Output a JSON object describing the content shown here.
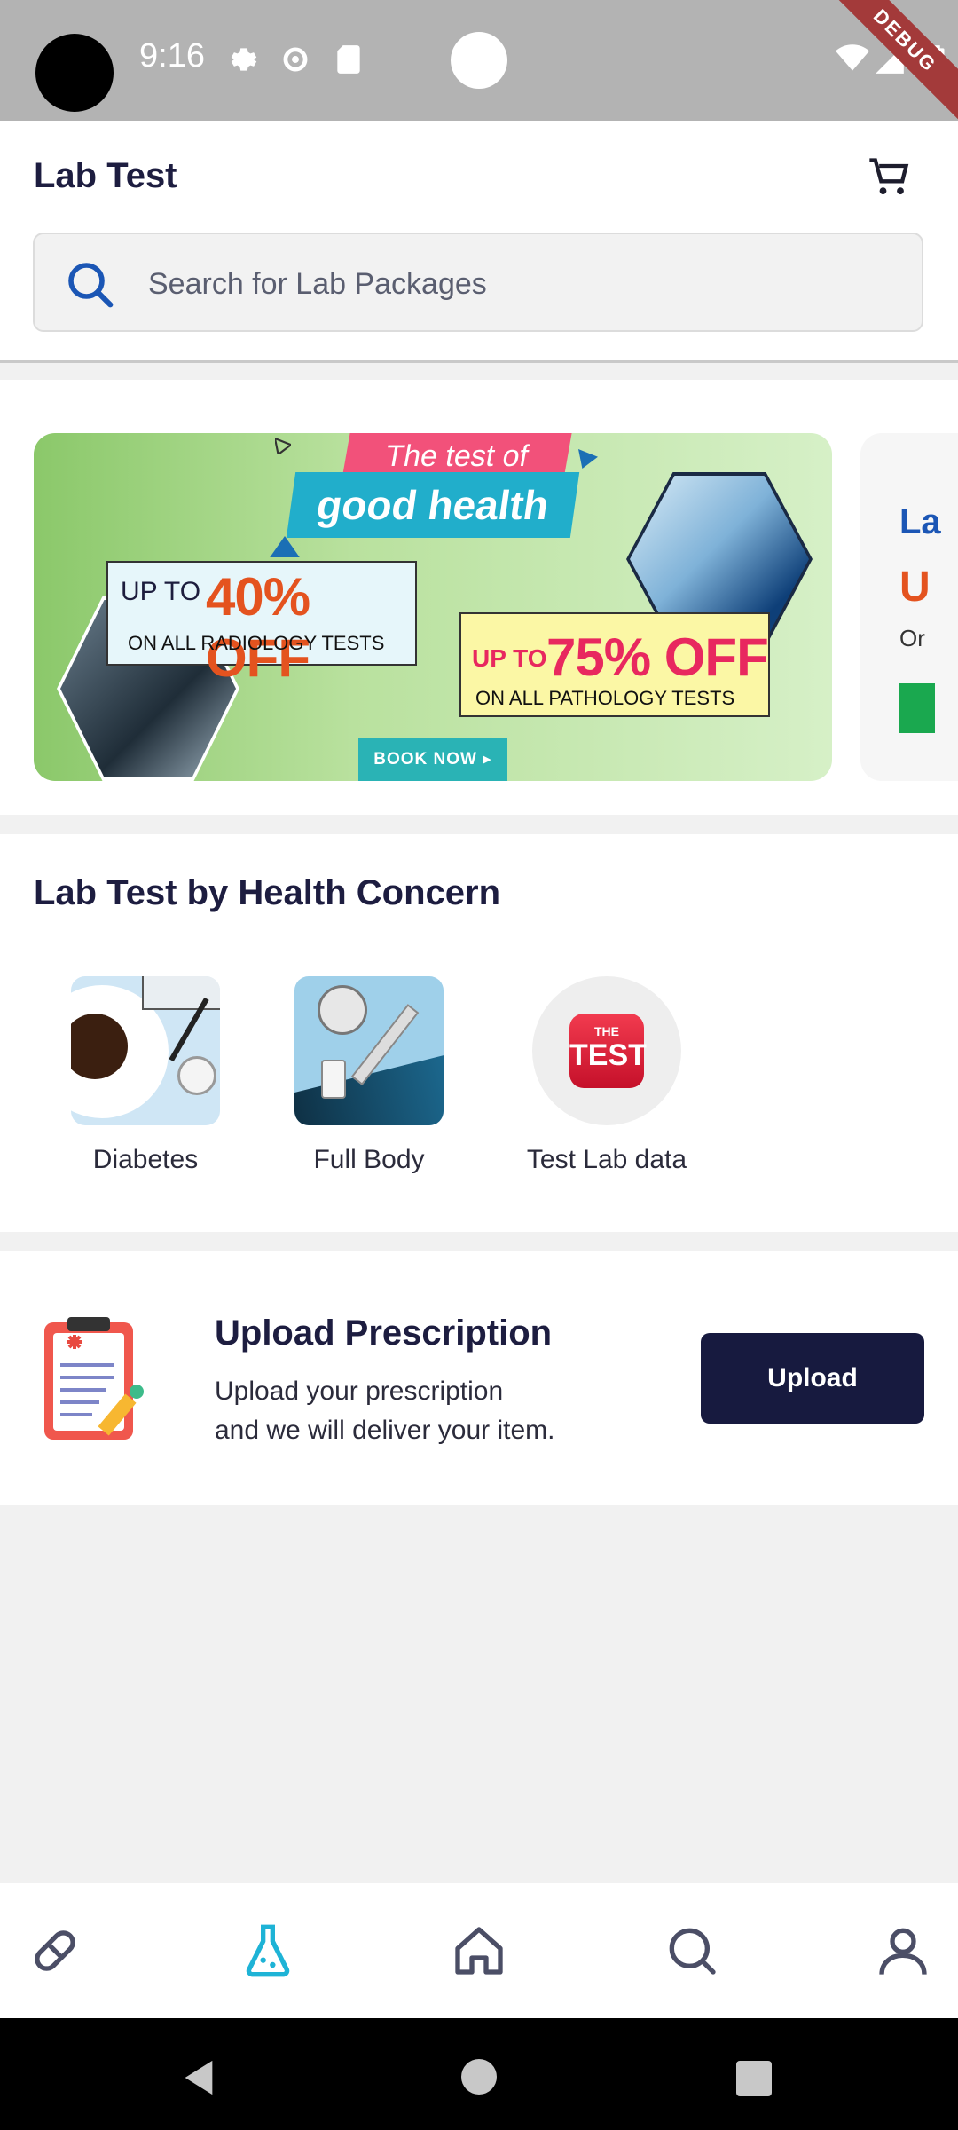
{
  "status_bar": {
    "time": "9:16",
    "debug_label": "DEBUG",
    "icons": [
      "settings-icon",
      "settings-icon",
      "sd-card-icon",
      "wifi-icon",
      "signal-icon",
      "battery-icon"
    ]
  },
  "header": {
    "title": "Lab Test",
    "cart_icon": "cart-icon"
  },
  "search": {
    "placeholder": "Search for Lab Packages",
    "value": ""
  },
  "banner": {
    "ribbon_top": "The test of",
    "ribbon_main": "good health",
    "offer1_prefix": "UP TO",
    "offer1_value": "40% OFF",
    "offer1_sub": "ON ALL RADIOLOGY TESTS",
    "offer2_prefix": "UP TO",
    "offer2_value": "75% OFF",
    "offer2_sub": "ON ALL PATHOLOGY TESTS",
    "book_now": "BOOK NOW ▸",
    "next_banner_letter1": "La",
    "next_banner_letter2": "U",
    "next_banner_letter3": "Or"
  },
  "health_concern": {
    "title": "Lab Test by Health Concern",
    "items": [
      {
        "label": "Diabetes"
      },
      {
        "label": "Full Body"
      },
      {
        "label": "Test Lab data",
        "logo_top": "THE",
        "logo_main": "TEST"
      }
    ]
  },
  "upload": {
    "title": "Upload Prescription",
    "line1": "Upload your prescription",
    "line2": "and we will deliver your item.",
    "button": "Upload"
  },
  "bottom_nav": {
    "items": [
      "pill-icon",
      "lab-flask-icon",
      "home-icon",
      "search-icon",
      "profile-icon"
    ],
    "active_color": "#1eb3d6",
    "inactive_color": "#4b4e66"
  },
  "colors": {
    "primary_dark": "#171a3f",
    "accent": "#1eb3d6"
  }
}
